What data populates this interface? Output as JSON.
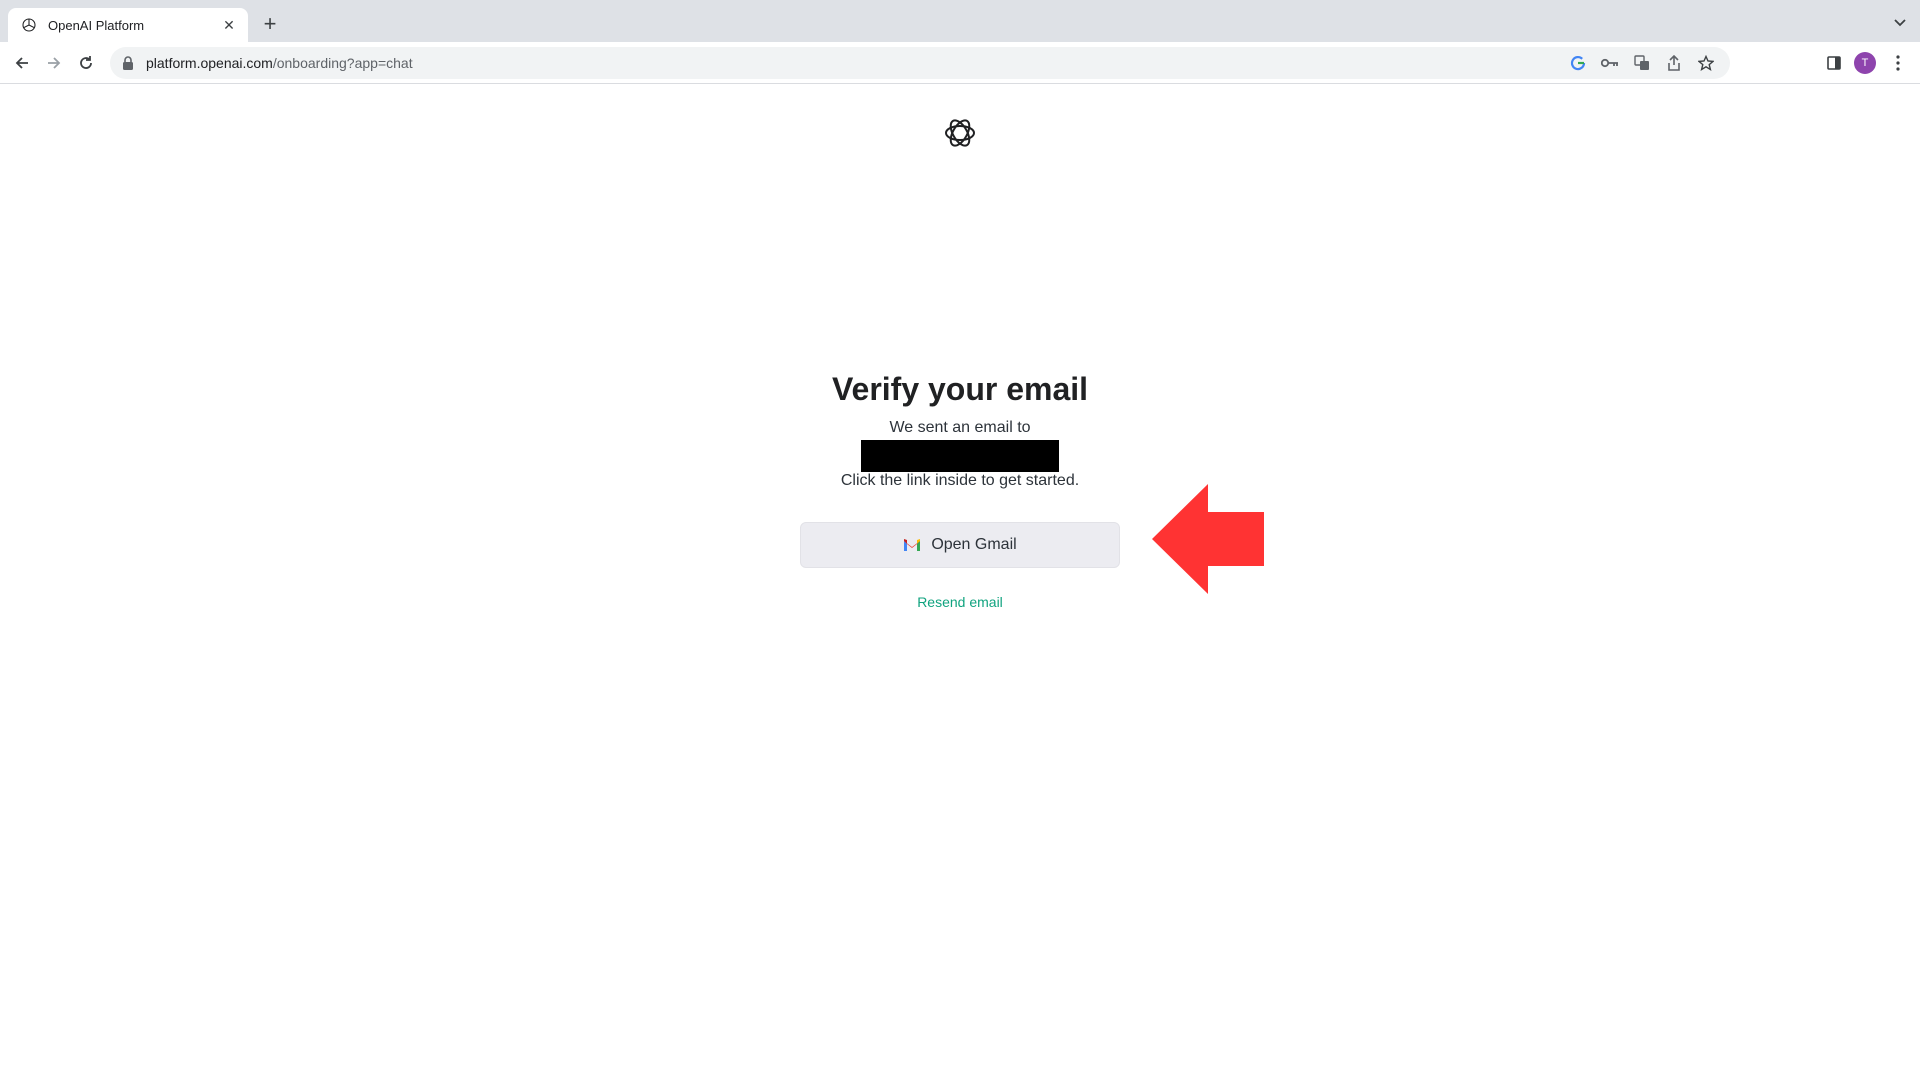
{
  "browser": {
    "tab_title": "OpenAI Platform",
    "tab_close": "✕",
    "new_tab": "+",
    "url_domain": "platform.openai.com",
    "url_path": "/onboarding?app=chat",
    "profile_initial": "T"
  },
  "page": {
    "heading": "Verify your email",
    "sent_text": "We sent an email to",
    "instruction": "Click the link inside to get started.",
    "open_gmail_label": "Open Gmail",
    "resend_label": "Resend email"
  },
  "colors": {
    "accent_green": "#10a37f",
    "annotation_arrow": "#ff3333",
    "button_bg": "#ececf1"
  },
  "icons": {
    "favicon": "openai-logo-icon",
    "gmail": "gmail-icon",
    "annotation": "red-arrow-left"
  }
}
